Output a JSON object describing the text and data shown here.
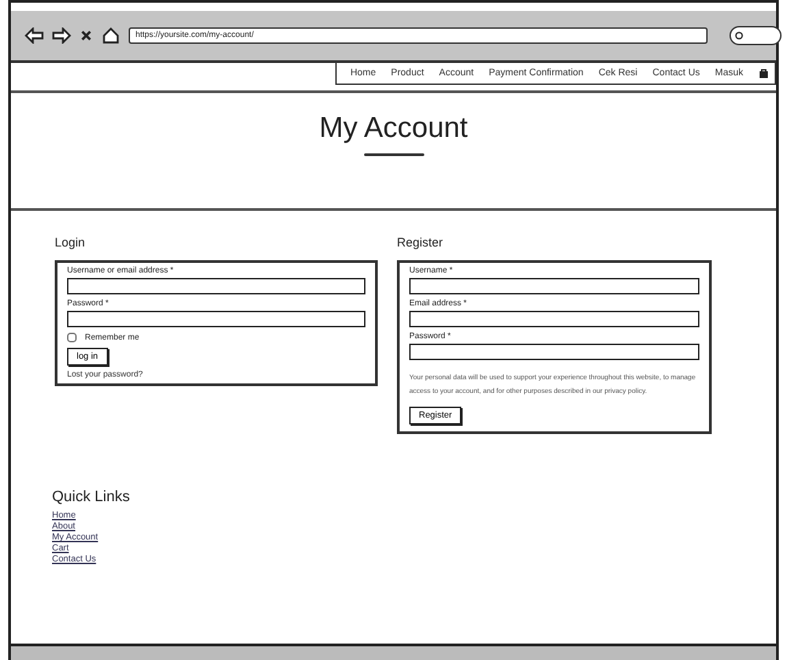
{
  "browser": {
    "url": "https://yoursite.com/my-account/"
  },
  "nav": [
    "Home",
    "Product",
    "Account",
    "Payment Confirmation",
    "Cek Resi",
    "Contact Us",
    "Masuk"
  ],
  "page_title": "My Account",
  "login": {
    "heading": "Login",
    "fields": [
      {
        "label": "Username or email address *"
      },
      {
        "label": "Password *"
      }
    ],
    "remember": {
      "label": "Remember me",
      "checked": false
    },
    "button": "log in",
    "lost": "Lost your password?"
  },
  "register": {
    "heading": "Register",
    "fields": [
      {
        "label": "Username *"
      },
      {
        "label": "Email address *"
      },
      {
        "label": "Password *"
      }
    ],
    "notice": "Your personal data will be used to support your experience throughout this website, to manage access to your account, and for other purposes described in our privacy policy.",
    "button": "Register"
  },
  "quick_links": {
    "heading": "Quick Links",
    "links": [
      "Home",
      "About",
      "My Account",
      "Cart",
      "Contact Us"
    ]
  }
}
